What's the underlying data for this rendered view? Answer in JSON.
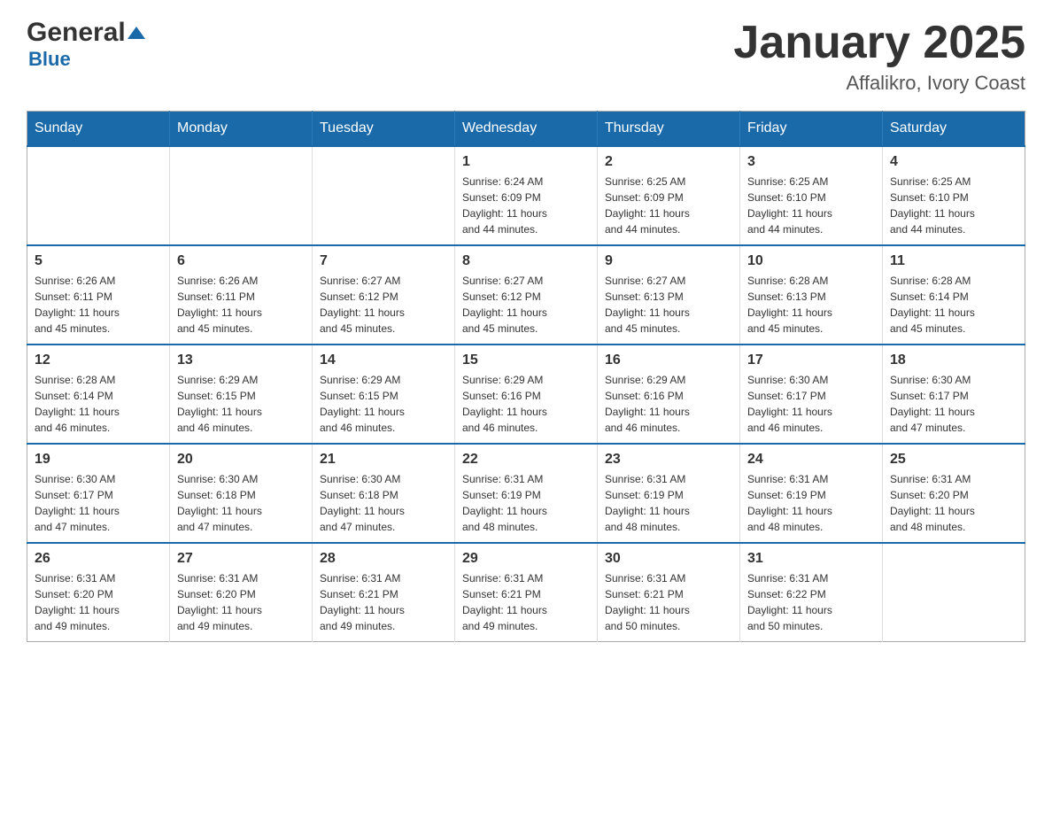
{
  "logo": {
    "general": "General",
    "blue": "Blue",
    "tagline": "Blue"
  },
  "header": {
    "title": "January 2025",
    "location": "Affalikro, Ivory Coast"
  },
  "weekdays": [
    "Sunday",
    "Monday",
    "Tuesday",
    "Wednesday",
    "Thursday",
    "Friday",
    "Saturday"
  ],
  "weeks": [
    [
      {
        "day": "",
        "info": ""
      },
      {
        "day": "",
        "info": ""
      },
      {
        "day": "",
        "info": ""
      },
      {
        "day": "1",
        "info": "Sunrise: 6:24 AM\nSunset: 6:09 PM\nDaylight: 11 hours\nand 44 minutes."
      },
      {
        "day": "2",
        "info": "Sunrise: 6:25 AM\nSunset: 6:09 PM\nDaylight: 11 hours\nand 44 minutes."
      },
      {
        "day": "3",
        "info": "Sunrise: 6:25 AM\nSunset: 6:10 PM\nDaylight: 11 hours\nand 44 minutes."
      },
      {
        "day": "4",
        "info": "Sunrise: 6:25 AM\nSunset: 6:10 PM\nDaylight: 11 hours\nand 44 minutes."
      }
    ],
    [
      {
        "day": "5",
        "info": "Sunrise: 6:26 AM\nSunset: 6:11 PM\nDaylight: 11 hours\nand 45 minutes."
      },
      {
        "day": "6",
        "info": "Sunrise: 6:26 AM\nSunset: 6:11 PM\nDaylight: 11 hours\nand 45 minutes."
      },
      {
        "day": "7",
        "info": "Sunrise: 6:27 AM\nSunset: 6:12 PM\nDaylight: 11 hours\nand 45 minutes."
      },
      {
        "day": "8",
        "info": "Sunrise: 6:27 AM\nSunset: 6:12 PM\nDaylight: 11 hours\nand 45 minutes."
      },
      {
        "day": "9",
        "info": "Sunrise: 6:27 AM\nSunset: 6:13 PM\nDaylight: 11 hours\nand 45 minutes."
      },
      {
        "day": "10",
        "info": "Sunrise: 6:28 AM\nSunset: 6:13 PM\nDaylight: 11 hours\nand 45 minutes."
      },
      {
        "day": "11",
        "info": "Sunrise: 6:28 AM\nSunset: 6:14 PM\nDaylight: 11 hours\nand 45 minutes."
      }
    ],
    [
      {
        "day": "12",
        "info": "Sunrise: 6:28 AM\nSunset: 6:14 PM\nDaylight: 11 hours\nand 46 minutes."
      },
      {
        "day": "13",
        "info": "Sunrise: 6:29 AM\nSunset: 6:15 PM\nDaylight: 11 hours\nand 46 minutes."
      },
      {
        "day": "14",
        "info": "Sunrise: 6:29 AM\nSunset: 6:15 PM\nDaylight: 11 hours\nand 46 minutes."
      },
      {
        "day": "15",
        "info": "Sunrise: 6:29 AM\nSunset: 6:16 PM\nDaylight: 11 hours\nand 46 minutes."
      },
      {
        "day": "16",
        "info": "Sunrise: 6:29 AM\nSunset: 6:16 PM\nDaylight: 11 hours\nand 46 minutes."
      },
      {
        "day": "17",
        "info": "Sunrise: 6:30 AM\nSunset: 6:17 PM\nDaylight: 11 hours\nand 46 minutes."
      },
      {
        "day": "18",
        "info": "Sunrise: 6:30 AM\nSunset: 6:17 PM\nDaylight: 11 hours\nand 47 minutes."
      }
    ],
    [
      {
        "day": "19",
        "info": "Sunrise: 6:30 AM\nSunset: 6:17 PM\nDaylight: 11 hours\nand 47 minutes."
      },
      {
        "day": "20",
        "info": "Sunrise: 6:30 AM\nSunset: 6:18 PM\nDaylight: 11 hours\nand 47 minutes."
      },
      {
        "day": "21",
        "info": "Sunrise: 6:30 AM\nSunset: 6:18 PM\nDaylight: 11 hours\nand 47 minutes."
      },
      {
        "day": "22",
        "info": "Sunrise: 6:31 AM\nSunset: 6:19 PM\nDaylight: 11 hours\nand 48 minutes."
      },
      {
        "day": "23",
        "info": "Sunrise: 6:31 AM\nSunset: 6:19 PM\nDaylight: 11 hours\nand 48 minutes."
      },
      {
        "day": "24",
        "info": "Sunrise: 6:31 AM\nSunset: 6:19 PM\nDaylight: 11 hours\nand 48 minutes."
      },
      {
        "day": "25",
        "info": "Sunrise: 6:31 AM\nSunset: 6:20 PM\nDaylight: 11 hours\nand 48 minutes."
      }
    ],
    [
      {
        "day": "26",
        "info": "Sunrise: 6:31 AM\nSunset: 6:20 PM\nDaylight: 11 hours\nand 49 minutes."
      },
      {
        "day": "27",
        "info": "Sunrise: 6:31 AM\nSunset: 6:20 PM\nDaylight: 11 hours\nand 49 minutes."
      },
      {
        "day": "28",
        "info": "Sunrise: 6:31 AM\nSunset: 6:21 PM\nDaylight: 11 hours\nand 49 minutes."
      },
      {
        "day": "29",
        "info": "Sunrise: 6:31 AM\nSunset: 6:21 PM\nDaylight: 11 hours\nand 49 minutes."
      },
      {
        "day": "30",
        "info": "Sunrise: 6:31 AM\nSunset: 6:21 PM\nDaylight: 11 hours\nand 50 minutes."
      },
      {
        "day": "31",
        "info": "Sunrise: 6:31 AM\nSunset: 6:22 PM\nDaylight: 11 hours\nand 50 minutes."
      },
      {
        "day": "",
        "info": ""
      }
    ]
  ]
}
